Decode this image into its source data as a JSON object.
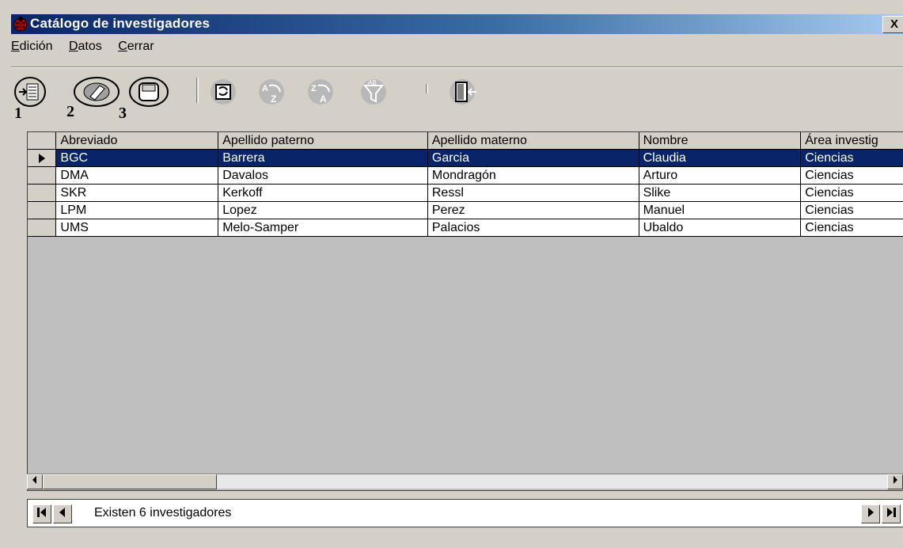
{
  "window": {
    "title": "Catálogo de investigadores",
    "close_label": "X"
  },
  "menu": {
    "items": [
      "Edición",
      "Datos",
      "Cerrar"
    ]
  },
  "toolbar": {
    "numbers": [
      "1",
      "2",
      "3"
    ],
    "buttons": [
      "new-record",
      "erase",
      "save",
      "refresh",
      "sort-az",
      "sort-za",
      "filter",
      "exit"
    ]
  },
  "grid": {
    "columns": [
      "Abreviado",
      "Apellido paterno",
      "Apellido materno",
      "Nombre",
      "Área investig"
    ],
    "rows": [
      [
        "BGC",
        "Barrera",
        "Garcia",
        "Claudia",
        "Ciencias"
      ],
      [
        "DMA",
        "Davalos",
        "Mondragón",
        "Arturo",
        "Ciencias"
      ],
      [
        "SKR",
        "Kerkoff",
        "Ressl",
        "Slike",
        "Ciencias"
      ],
      [
        "LPM",
        "Lopez",
        "Perez",
        "Manuel",
        "Ciencias"
      ],
      [
        "UMS",
        "Melo-Samper",
        "Palacios",
        "Ubaldo",
        "Ciencias"
      ]
    ],
    "selected_row": 0
  },
  "status": {
    "text": "Existen 6 investigadores"
  },
  "colors": {
    "title_start": "#0a246a",
    "title_end": "#a6caf0",
    "selection": "#0a246a",
    "face": "#d4d0c8"
  }
}
